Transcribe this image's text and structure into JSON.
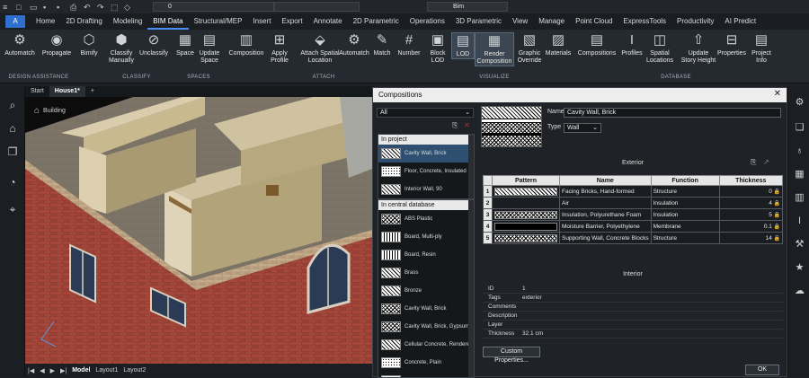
{
  "qat": {
    "layer_value": "0",
    "workspace_value": "Bim"
  },
  "app_button": "A",
  "tabs": [
    "Home",
    "2D Drafting",
    "Modeling",
    "BIM Data",
    "Structural/MEP",
    "Insert",
    "Export",
    "Annotate",
    "2D Parametric",
    "Operations",
    "3D Parametric",
    "View",
    "Manage",
    "Point Cloud",
    "ExpressTools",
    "Productivity",
    "AI Predict"
  ],
  "active_tab": "BIM Data",
  "ribbon": {
    "buttons": [
      "Automatch",
      "Propagate",
      "Bimify",
      "Classify\nManually",
      "Unclassify",
      "Space",
      "Update\nSpace",
      "Composition",
      "Apply\nProfile",
      "Attach Spatial\nLocation",
      "Automatch",
      "Match",
      "Number",
      "Block\nLOD",
      "LOD",
      "Render\nComposition",
      "Graphic\nOverride",
      "Materials",
      "Compositions",
      "Profiles",
      "Spatial\nLocations",
      "Update\nStory Height",
      "Properties",
      "Project\nInfo"
    ],
    "groups": [
      "DESIGN ASSISTANCE",
      "CLASSIFY",
      "SPACES",
      "ATTACH",
      "VISUALIZE",
      "DATABASE"
    ]
  },
  "doc_tabs": [
    "Start",
    "House1*"
  ],
  "viewport": {
    "breadcrumb": "Building"
  },
  "layout_tabs": [
    "Model",
    "Layout1",
    "Layout2"
  ],
  "dialog": {
    "title": "Compositions",
    "filter": "All",
    "in_project_header": "In project",
    "in_project": [
      {
        "name": "Cavity Wall, Brick",
        "pattern": "hatch"
      },
      {
        "name": "Floor, Concrete, Insulated",
        "pattern": "dots"
      },
      {
        "name": "Interior Wall, 90",
        "pattern": "hatch"
      }
    ],
    "central_header": "In central database",
    "central": [
      {
        "name": "ABS Plastic",
        "pattern": "hatchx"
      },
      {
        "name": "Board, Multi-ply",
        "pattern": "vlines"
      },
      {
        "name": "Board, Resin",
        "pattern": "vlines"
      },
      {
        "name": "Brass",
        "pattern": "hatch"
      },
      {
        "name": "Bronze",
        "pattern": "hatch"
      },
      {
        "name": "Cavity Wall, Brick",
        "pattern": "hatchx"
      },
      {
        "name": "Cavity Wall, Brick, Gypsum",
        "pattern": "hatchx"
      },
      {
        "name": "Cellular Concrete, Rendered",
        "pattern": "hatch"
      },
      {
        "name": "Concrete, Plain",
        "pattern": "dots"
      },
      {
        "name": "Concrete, Precast",
        "pattern": "dots"
      }
    ],
    "name_label": "Name",
    "name_value": "Cavity Wall, Brick",
    "type_label": "Type",
    "type_value": "Wall",
    "exterior_label": "Exterior",
    "interior_label": "Interior",
    "table_headers": [
      "Pattern",
      "Name",
      "Function",
      "Thickness"
    ],
    "layers": [
      {
        "n": "1",
        "pattern": "hatch",
        "name": "Facing Bricks, Hand-formed",
        "function": "Structure",
        "thickness": "0"
      },
      {
        "n": "2",
        "pattern": "none",
        "name": "Air",
        "function": "Insulation",
        "thickness": "4"
      },
      {
        "n": "3",
        "pattern": "hatchx",
        "name": "Insulation, Polyurethane Foam",
        "function": "Insulation",
        "thickness": "5"
      },
      {
        "n": "4",
        "pattern": "solidblack",
        "name": "Moisture Barrier, Polyethylene",
        "function": "Membrane",
        "thickness": "0.1"
      },
      {
        "n": "5",
        "pattern": "hatchx",
        "name": "Supporting Wall, Concrete Blocks",
        "function": "Structure",
        "thickness": "14"
      }
    ],
    "info": [
      {
        "k": "ID",
        "v": "1"
      },
      {
        "k": "Tags",
        "v": "exterior"
      },
      {
        "k": "Comments",
        "v": ""
      },
      {
        "k": "Description",
        "v": ""
      },
      {
        "k": "Layer",
        "v": ""
      },
      {
        "k": "Thickness",
        "v": "32.1 cm"
      }
    ],
    "custom_props_label": "Custom Properties...",
    "ok_label": "OK"
  }
}
